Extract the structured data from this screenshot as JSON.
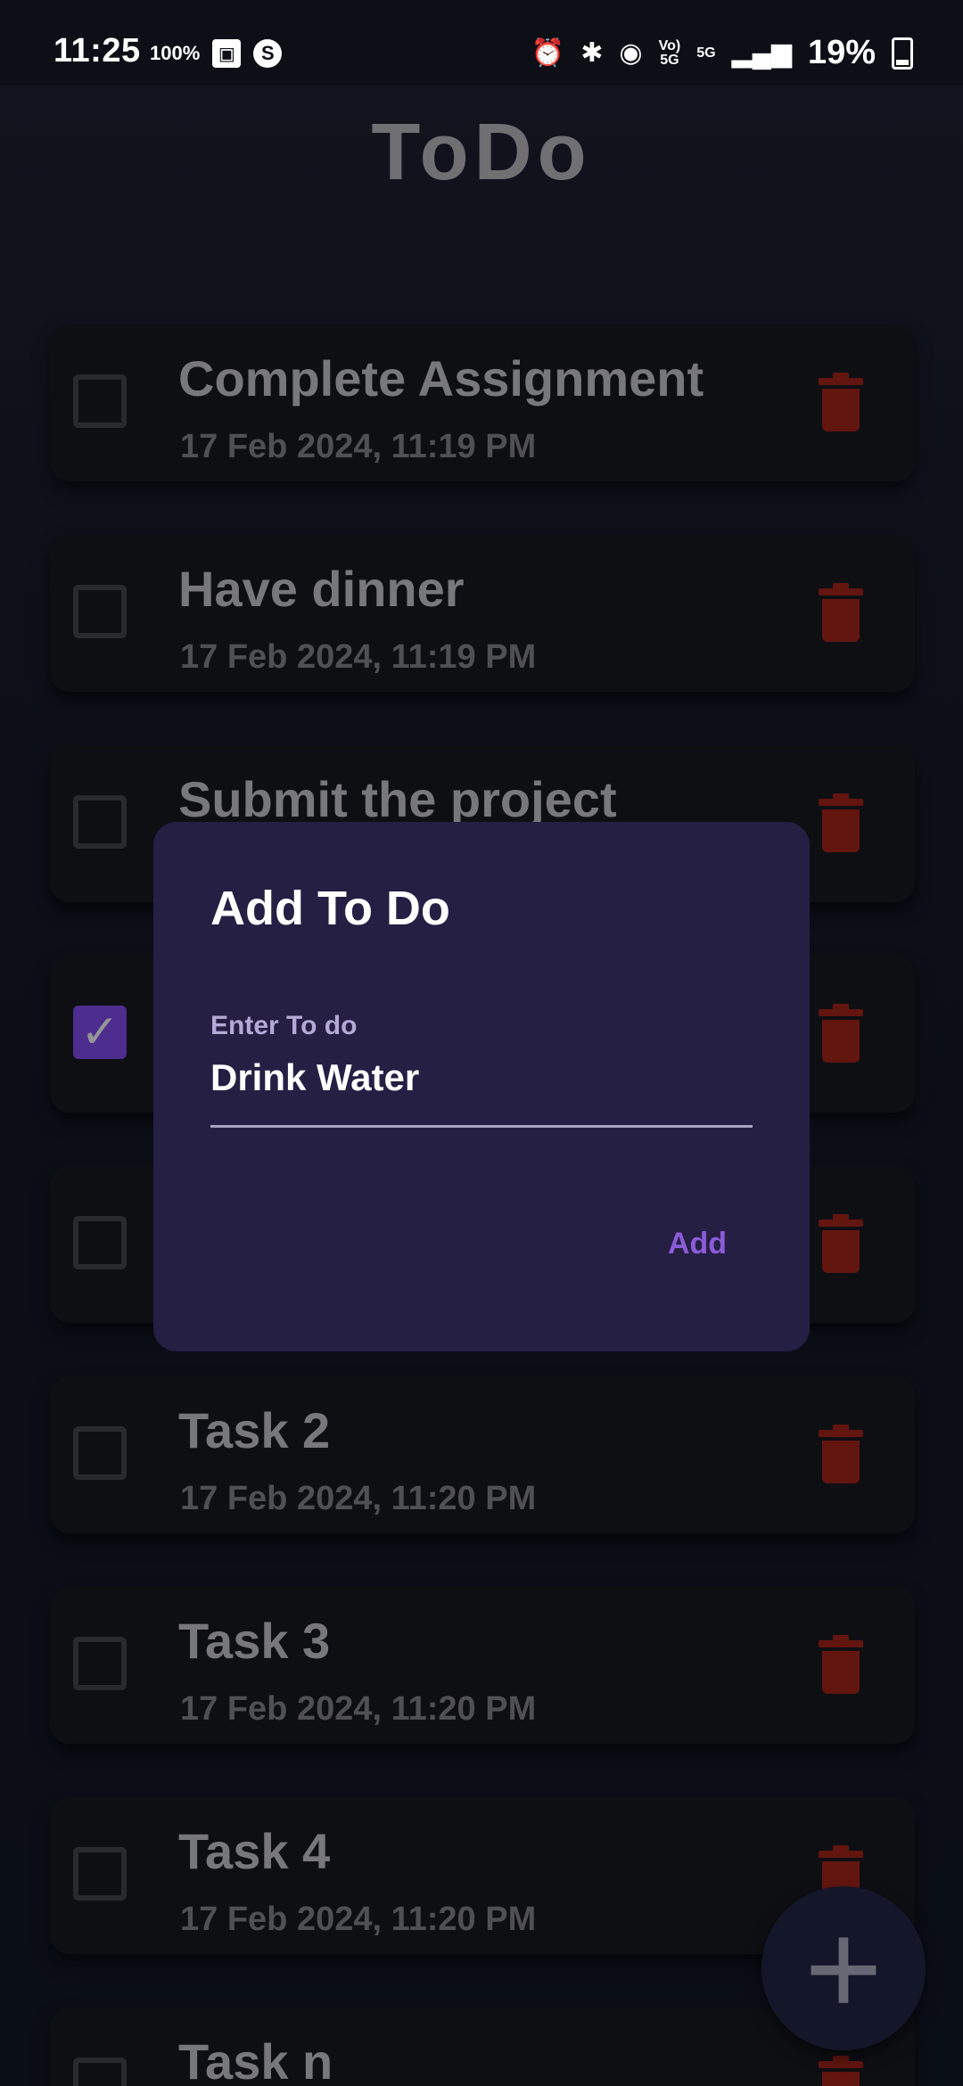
{
  "status_bar": {
    "time": "11:25",
    "left_badge": "100%",
    "right_small_1": "Vo)\n5G",
    "right_small_2": "5G",
    "battery_percent": "19%"
  },
  "app": {
    "title": "ToDo",
    "fab_label": "+"
  },
  "tasks": [
    {
      "title": "Complete Assignment",
      "date": "17 Feb 2024, 11:19 PM",
      "checked": false
    },
    {
      "title": "Have dinner",
      "date": "17 Feb 2024, 11:19 PM",
      "checked": false
    },
    {
      "title": "Submit the project",
      "date": "",
      "checked": false
    },
    {
      "title": "",
      "date": "",
      "checked": true
    },
    {
      "title": "",
      "date": "",
      "checked": false
    },
    {
      "title": "Task 2",
      "date": "17 Feb 2024, 11:20 PM",
      "checked": false
    },
    {
      "title": "Task 3",
      "date": "17 Feb 2024, 11:20 PM",
      "checked": false
    },
    {
      "title": "Task 4",
      "date": "17 Feb 2024, 11:20 PM",
      "checked": false
    },
    {
      "title": "Task n",
      "date": "",
      "checked": false
    }
  ],
  "dialog": {
    "title": "Add To Do",
    "field_label": "Enter To do",
    "field_value": "Drink Water",
    "add_button": "Add"
  },
  "colors": {
    "accent": "#6b3fc5",
    "delete": "#8a1e17",
    "dialog_bg": "#251f44"
  }
}
